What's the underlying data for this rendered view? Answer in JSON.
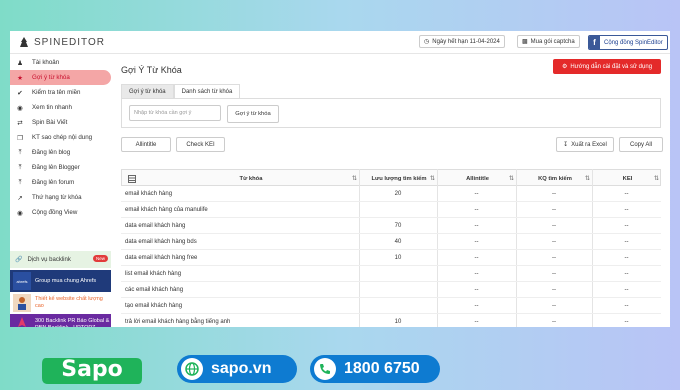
{
  "app": {
    "logo_text": "SPINEDITOR",
    "expiry": "Ngày hết hạn 11-04-2024",
    "captcha": "Mua gói captcha",
    "community": "Cộng đồng SpinEditor"
  },
  "sidebar": {
    "items": [
      {
        "label": "Tài khoản",
        "icon": "user-icon"
      },
      {
        "label": "Gợi ý từ khóa",
        "icon": "star-icon"
      },
      {
        "label": "Kiểm tra tên miền",
        "icon": "check-icon"
      },
      {
        "label": "Xem tin nhanh",
        "icon": "eye-icon"
      },
      {
        "label": "Spin Bài Viết",
        "icon": "shuffle-icon"
      },
      {
        "label": "KT sao chép nội dung",
        "icon": "copy-icon"
      },
      {
        "label": "Đăng lên blog",
        "icon": "upload-icon"
      },
      {
        "label": "Đăng lên Blogger",
        "icon": "upload-icon"
      },
      {
        "label": "Đăng lên forum",
        "icon": "upload-icon"
      },
      {
        "label": "Thứ hạng từ khóa",
        "icon": "chart-icon"
      },
      {
        "label": "Cộng đồng View",
        "icon": "eye-icon"
      }
    ],
    "promo_label": "Dịch vụ backlink",
    "promo_badge": "New",
    "ads": [
      {
        "label": "Group mua chung Ahrefs",
        "thumb_text": "ahrefs"
      },
      {
        "label": "Thiết kế website chất lượng cao"
      },
      {
        "label": "300 Backlink PR Báo Global & PBN Backlink - UPTOPZ"
      }
    ]
  },
  "main": {
    "title": "Gợi Ý Từ Khóa",
    "guide_button": "Hướng dẫn cài đặt và sử dụng",
    "tabs": [
      "Gợi ý từ khóa",
      "Danh sách từ khóa"
    ],
    "input_placeholder": "Nhập từ khóa cần gợi ý",
    "suggest_button": "Gợi ý từ khóa",
    "allintitle_button": "Allintitle",
    "checkkei_button": "Check KEI",
    "export_button": "Xuất ra Excel",
    "copy_button": "Copy All"
  },
  "table": {
    "headers": [
      "Từ khóa",
      "Lưu lượng tìm kiếm",
      "Allintitle",
      "KQ tìm kiếm",
      "KEI"
    ],
    "rows": [
      {
        "kw": "email khách hàng",
        "vol": "20",
        "allin": "--",
        "kq": "--",
        "kei": "--"
      },
      {
        "kw": "email khách hàng của manulife",
        "vol": "",
        "allin": "--",
        "kq": "--",
        "kei": "--"
      },
      {
        "kw": "data email khách hàng",
        "vol": "70",
        "allin": "--",
        "kq": "--",
        "kei": "--"
      },
      {
        "kw": "data email khách hàng bds",
        "vol": "40",
        "allin": "--",
        "kq": "--",
        "kei": "--"
      },
      {
        "kw": "data email khách hàng free",
        "vol": "10",
        "allin": "--",
        "kq": "--",
        "kei": "--"
      },
      {
        "kw": "list email khách hàng",
        "vol": "",
        "allin": "--",
        "kq": "--",
        "kei": "--"
      },
      {
        "kw": "các email khách hàng",
        "vol": "",
        "allin": "--",
        "kq": "--",
        "kei": "--"
      },
      {
        "kw": "tạo email khách hàng",
        "vol": "",
        "allin": "--",
        "kq": "--",
        "kei": "--"
      },
      {
        "kw": "trả lời email khách hàng bằng tiếng anh",
        "vol": "10",
        "allin": "--",
        "kq": "--",
        "kei": "--"
      }
    ]
  },
  "footer": {
    "brand": "Sapo",
    "site": "sapo.vn",
    "phone": "1800 6750"
  },
  "colors": {
    "accent_red": "#e42a2a",
    "active_bg": "#f4a6a6",
    "brand_blue": "#0e7bd1",
    "sapo_green": "#1fb35a"
  }
}
